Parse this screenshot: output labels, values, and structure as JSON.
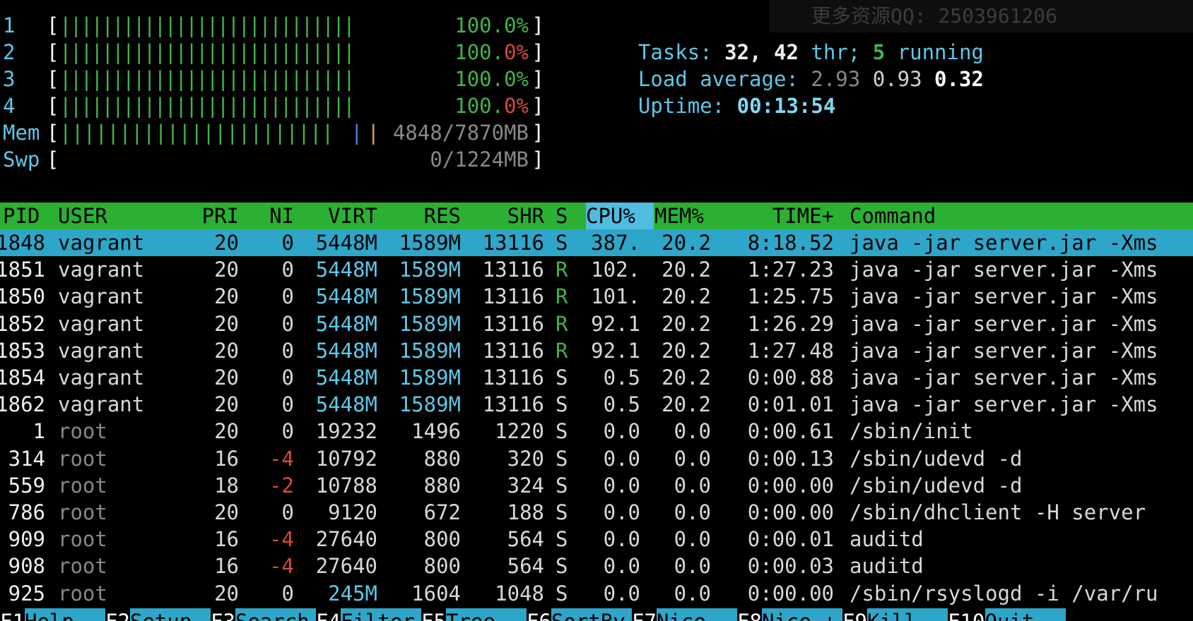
{
  "meters": [
    {
      "label": "1",
      "bar": "||||||||||||||||||||||||||||",
      "value_a": "100.",
      "value_b": "0%",
      "b_color": "green"
    },
    {
      "label": "2",
      "bar": "||||||||||||||||||||||||||||",
      "value_a": "100.",
      "value_b": "0%",
      "b_color": "red"
    },
    {
      "label": "3",
      "bar": "||||||||||||||||||||||||||||",
      "value_a": "100.",
      "value_b": "0%",
      "b_color": "green"
    },
    {
      "label": "4",
      "bar": "||||||||||||||||||||||||||||",
      "value_a": "100.",
      "value_b": "0%",
      "b_color": "red"
    },
    {
      "label": "Mem",
      "bar": "|||||||||||||||||||||||",
      "value_a": "4848/7870MB",
      "value_b": "",
      "b_color": "gray"
    },
    {
      "label": "Swp",
      "bar": "",
      "value_a": "0/1224MB",
      "value_b": "",
      "b_color": "gray"
    }
  ],
  "info": {
    "tasks_label": "Tasks:",
    "tasks_count": "32,",
    "threads_count": "42",
    "threads_label": "thr;",
    "running_count": "5",
    "running_label": "running",
    "load_label": "Load average:",
    "load1": "2.93",
    "load5": "0.93",
    "load15": "0.32",
    "uptime_label": "Uptime:",
    "uptime_value": "00:13:54"
  },
  "watermark": "更多资源QQ: 2503961206",
  "columns": {
    "pid": "PID",
    "user": "USER",
    "pri": "PRI",
    "ni": "NI",
    "virt": "VIRT",
    "res": "RES",
    "shr": "SHR",
    "s": "S",
    "cpu": "CPU%",
    "mem": "MEM%",
    "time": "TIME+",
    "cmd": "Command"
  },
  "rows": [
    {
      "pid": "1848",
      "user": "vagrant",
      "pri": "20",
      "ni": "0",
      "virt": "5448M",
      "res": "1589M",
      "shr": "13116",
      "s": "S",
      "cpu": "387.",
      "mem": "20.2",
      "time": "8:18.52",
      "cmd": "java -jar server.jar -Xms"
    },
    {
      "pid": "1851",
      "user": "vagrant",
      "pri": "20",
      "ni": "0",
      "virt": "5448M",
      "res": "1589M",
      "shr": "13116",
      "s": "R",
      "cpu": "102.",
      "mem": "20.2",
      "time": "1:27.23",
      "cmd": "java -jar server.jar -Xms"
    },
    {
      "pid": "1850",
      "user": "vagrant",
      "pri": "20",
      "ni": "0",
      "virt": "5448M",
      "res": "1589M",
      "shr": "13116",
      "s": "R",
      "cpu": "101.",
      "mem": "20.2",
      "time": "1:25.75",
      "cmd": "java -jar server.jar -Xms"
    },
    {
      "pid": "1852",
      "user": "vagrant",
      "pri": "20",
      "ni": "0",
      "virt": "5448M",
      "res": "1589M",
      "shr": "13116",
      "s": "R",
      "cpu": "92.1",
      "mem": "20.2",
      "time": "1:26.29",
      "cmd": "java -jar server.jar -Xms"
    },
    {
      "pid": "1853",
      "user": "vagrant",
      "pri": "20",
      "ni": "0",
      "virt": "5448M",
      "res": "1589M",
      "shr": "13116",
      "s": "R",
      "cpu": "92.1",
      "mem": "20.2",
      "time": "1:27.48",
      "cmd": "java -jar server.jar -Xms"
    },
    {
      "pid": "1854",
      "user": "vagrant",
      "pri": "20",
      "ni": "0",
      "virt": "5448M",
      "res": "1589M",
      "shr": "13116",
      "s": "S",
      "cpu": "0.5",
      "mem": "20.2",
      "time": "0:00.88",
      "cmd": "java -jar server.jar -Xms"
    },
    {
      "pid": "1862",
      "user": "vagrant",
      "pri": "20",
      "ni": "0",
      "virt": "5448M",
      "res": "1589M",
      "shr": "13116",
      "s": "S",
      "cpu": "0.5",
      "mem": "20.2",
      "time": "0:01.01",
      "cmd": "java -jar server.jar -Xms"
    },
    {
      "pid": "1",
      "user": "root",
      "pri": "20",
      "ni": "0",
      "virt": "19232",
      "res": "1496",
      "shr": "1220",
      "s": "S",
      "cpu": "0.0",
      "mem": "0.0",
      "time": "0:00.61",
      "cmd": "/sbin/init"
    },
    {
      "pid": "314",
      "user": "root",
      "pri": "16",
      "ni": "-4",
      "virt": "10792",
      "res": "880",
      "shr": "320",
      "s": "S",
      "cpu": "0.0",
      "mem": "0.0",
      "time": "0:00.13",
      "cmd": "/sbin/udevd -d"
    },
    {
      "pid": "559",
      "user": "root",
      "pri": "18",
      "ni": "-2",
      "virt": "10788",
      "res": "880",
      "shr": "324",
      "s": "S",
      "cpu": "0.0",
      "mem": "0.0",
      "time": "0:00.00",
      "cmd": "/sbin/udevd -d"
    },
    {
      "pid": "786",
      "user": "root",
      "pri": "20",
      "ni": "0",
      "virt": "9120",
      "res": "672",
      "shr": "188",
      "s": "S",
      "cpu": "0.0",
      "mem": "0.0",
      "time": "0:00.00",
      "cmd": "/sbin/dhclient -H server"
    },
    {
      "pid": "909",
      "user": "root",
      "pri": "16",
      "ni": "-4",
      "virt": "27640",
      "res": "800",
      "shr": "564",
      "s": "S",
      "cpu": "0.0",
      "mem": "0.0",
      "time": "0:00.01",
      "cmd": "auditd"
    },
    {
      "pid": "908",
      "user": "root",
      "pri": "16",
      "ni": "-4",
      "virt": "27640",
      "res": "800",
      "shr": "564",
      "s": "S",
      "cpu": "0.0",
      "mem": "0.0",
      "time": "0:00.03",
      "cmd": "auditd"
    },
    {
      "pid": "925",
      "user": "root",
      "pri": "20",
      "ni": "0",
      "virt": "245M",
      "res": "1604",
      "shr": "1048",
      "s": "S",
      "cpu": "0.0",
      "mem": "0.0",
      "time": "0:00.00",
      "cmd": "/sbin/rsyslogd -i /var/ru"
    }
  ],
  "footer": [
    {
      "key": "F1",
      "label": "Help"
    },
    {
      "key": "F2",
      "label": "Setup"
    },
    {
      "key": "F3",
      "label": "Search"
    },
    {
      "key": "F4",
      "label": "Filter"
    },
    {
      "key": "F5",
      "label": "Tree"
    },
    {
      "key": "F6",
      "label": "SortBy"
    },
    {
      "key": "F7",
      "label": "Nice -"
    },
    {
      "key": "F8",
      "label": "Nice +"
    },
    {
      "key": "F9",
      "label": "Kill"
    },
    {
      "key": "F10",
      "label": "Quit"
    }
  ],
  "colors": {
    "header_bg": "#2bb033",
    "selected_bg": "#2ea6c9",
    "cyan": "#5ec7e6",
    "green": "#3fb34a",
    "red": "#d64a3a"
  }
}
